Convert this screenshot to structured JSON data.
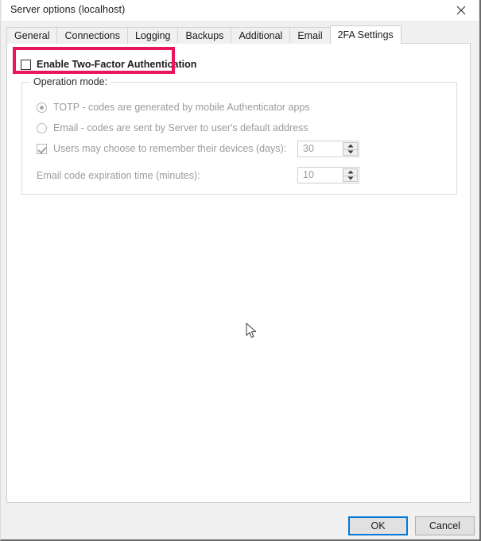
{
  "window": {
    "title": "Server options (localhost)",
    "close_icon": "close-icon"
  },
  "tabs": [
    {
      "label": "General",
      "active": false
    },
    {
      "label": "Connections",
      "active": false
    },
    {
      "label": "Logging",
      "active": false
    },
    {
      "label": "Backups",
      "active": false
    },
    {
      "label": "Additional",
      "active": false
    },
    {
      "label": "Email",
      "active": false
    },
    {
      "label": "2FA Settings",
      "active": true
    }
  ],
  "content": {
    "enable_2fa": {
      "label": "Enable Two-Factor Authentication",
      "checked": false
    },
    "group": {
      "title": "Operation mode:",
      "radios": [
        {
          "label": "TOTP - codes are generated by mobile Authenticator apps",
          "selected": true
        },
        {
          "label": "Email - codes are sent by Server to user's default address",
          "selected": false
        }
      ],
      "remember_devices": {
        "label": "Users may choose to remember their devices (days):",
        "checked": true,
        "value": "30"
      },
      "email_expiration": {
        "label": "Email code expiration time (minutes):",
        "value": "10"
      }
    }
  },
  "footer": {
    "ok_label": "OK",
    "cancel_label": "Cancel"
  },
  "annotation": {
    "highlight_color": "#e8175d"
  }
}
